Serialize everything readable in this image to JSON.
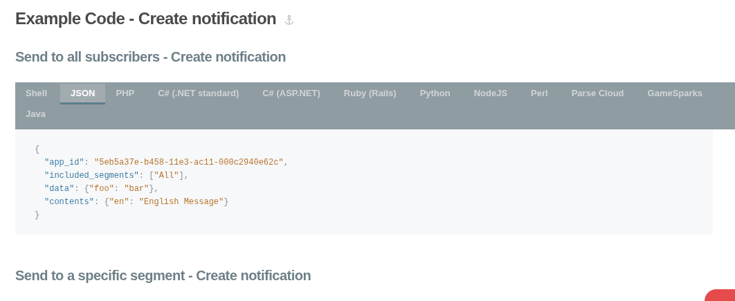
{
  "heading": "Example Code - Create notification",
  "subheading": "Send to all subscribers - Create notification",
  "tabs": [
    {
      "label": "Shell",
      "selected": false
    },
    {
      "label": "JSON",
      "selected": true
    },
    {
      "label": "PHP",
      "selected": false
    },
    {
      "label": "C# (.NET standard)",
      "selected": false
    },
    {
      "label": "C# (ASP.NET)",
      "selected": false
    },
    {
      "label": "Ruby (Rails)",
      "selected": false
    },
    {
      "label": "Python",
      "selected": false
    },
    {
      "label": "NodeJS",
      "selected": false
    },
    {
      "label": "Perl",
      "selected": false
    },
    {
      "label": "Parse Cloud",
      "selected": false
    },
    {
      "label": "GameSparks",
      "selected": false
    },
    {
      "label": "Java",
      "selected": false
    }
  ],
  "code": {
    "open": "{",
    "members": [
      [
        {
          "kind": "key",
          "text": "\"app_id\""
        },
        {
          "kind": "punct",
          "text": ": "
        },
        {
          "kind": "string",
          "text": "\"5eb5a37e-b458-11e3-ac11-000c2940e62c\""
        },
        {
          "kind": "punct",
          "text": ","
        }
      ],
      [
        {
          "kind": "key",
          "text": "\"included_segments\""
        },
        {
          "kind": "punct",
          "text": ": ["
        },
        {
          "kind": "string",
          "text": "\"All\""
        },
        {
          "kind": "punct",
          "text": "],"
        }
      ],
      [
        {
          "kind": "key",
          "text": "\"data\""
        },
        {
          "kind": "punct",
          "text": ": {"
        },
        {
          "kind": "string",
          "text": "\"foo\""
        },
        {
          "kind": "punct",
          "text": ": "
        },
        {
          "kind": "string",
          "text": "\"bar\""
        },
        {
          "kind": "punct",
          "text": "},"
        }
      ],
      [
        {
          "kind": "key",
          "text": "\"contents\""
        },
        {
          "kind": "punct",
          "text": ": {"
        },
        {
          "kind": "string",
          "text": "\"en\""
        },
        {
          "kind": "punct",
          "text": ": "
        },
        {
          "kind": "string",
          "text": "\"English Message\""
        },
        {
          "kind": "punct",
          "text": "}"
        }
      ]
    ],
    "close": "}"
  },
  "next_heading": "Send to a specific segment - Create notification"
}
